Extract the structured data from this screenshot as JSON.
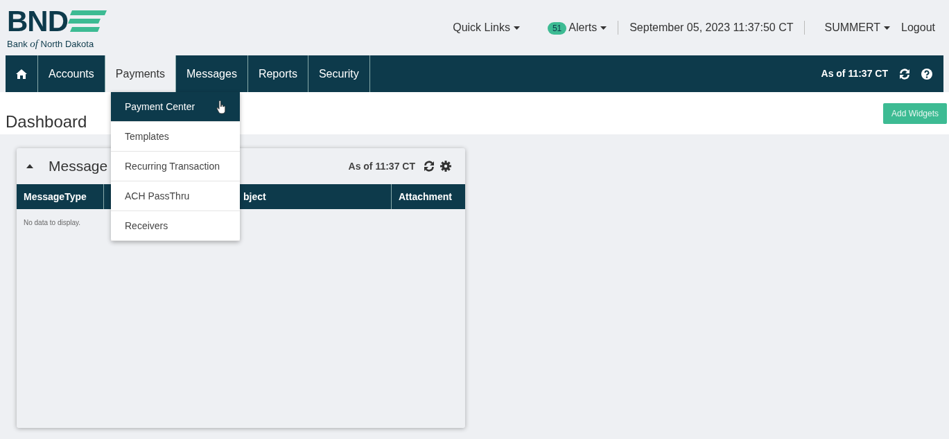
{
  "logo": {
    "mark": "BND",
    "tagline_before": "Bank",
    "tagline_italic": "of",
    "tagline_after": "North Dakota"
  },
  "header_links": [
    {
      "kind": "dropdown",
      "label": "Quick Links"
    },
    {
      "kind": "alerts",
      "label": "Alerts",
      "count": "51"
    },
    {
      "kind": "text",
      "label": "September 05, 2023 11:37:50 CT"
    },
    {
      "kind": "dropdown",
      "label": "SUMMERT"
    },
    {
      "kind": "link",
      "label": "Logout"
    }
  ],
  "nav": {
    "tabs": [
      {
        "kind": "home",
        "selected": false
      },
      {
        "label": "Accounts",
        "selected": false
      },
      {
        "label": "Payments",
        "selected": true
      },
      {
        "label": "Messages",
        "selected": false
      },
      {
        "label": "Reports",
        "selected": false
      },
      {
        "label": "Security",
        "selected": false
      }
    ],
    "as_of": "As of 11:37 CT"
  },
  "dropdown": {
    "items": [
      {
        "label": "Payment Center",
        "selected": true
      },
      {
        "label": "Templates",
        "selected": false
      },
      {
        "label": "Recurring Transaction",
        "selected": false
      },
      {
        "label": "ACH PassThru",
        "selected": false
      },
      {
        "label": "Receivers",
        "selected": false
      }
    ]
  },
  "page_title": "Dashboard",
  "add_button": "Add Widgets",
  "widget": {
    "title": "Message",
    "expanded": true,
    "as_of": "As of 11:37 CT",
    "columns": [
      "MessageType",
      "bject",
      "Attachment"
    ],
    "empty_text": "No data to display."
  }
}
